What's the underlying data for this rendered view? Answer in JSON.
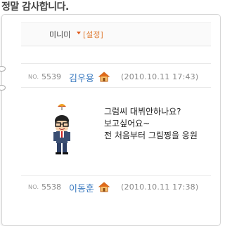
{
  "header": {
    "title": "정말 감사합니다."
  },
  "mini_bar": {
    "label": "미니미",
    "setting_label": "[설정]"
  },
  "entries": [
    {
      "no_label": "NO.",
      "no": "5539",
      "author": "김우용",
      "datetime": "(2010.10.11 17:43)",
      "lines": [
        "그럼씨 대뷔안하나요?",
        "보고싶어요~",
        "전 처음부터 그림찡을 응원"
      ]
    },
    {
      "no_label": "NO.",
      "no": "5538",
      "author": "이동훈",
      "datetime": "(2010.10.11 17:38)"
    }
  ],
  "icons": {
    "home": "home-icon",
    "umbrella": "umbrella-icon",
    "avatar": "minime-avatar",
    "dropdown": "chevron-down-icon"
  },
  "colors": {
    "author": "#3c7bc0",
    "setting": "#e0803a",
    "home_roof": "#e06a1a",
    "umbrella": "#f0a020"
  }
}
